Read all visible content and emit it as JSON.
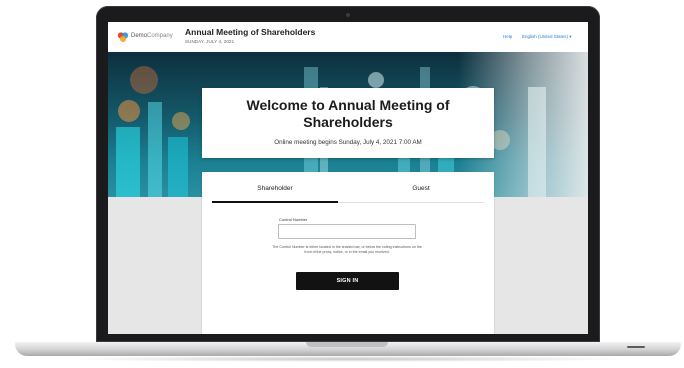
{
  "brand": {
    "logo_name": "DemoCompany",
    "logo_part1": "Demo",
    "logo_part2": "Company"
  },
  "header": {
    "title": "Annual Meeting of Shareholders",
    "date": "SUNDAY, JULY 4, 2021",
    "help_link": "Help",
    "language": "English (United States)",
    "language_icon": "chevron-down-icon"
  },
  "welcome": {
    "title": "Welcome to Annual Meeting of Shareholders",
    "subtitle": "Online meeting begins Sunday, July 4, 2021 7:00 AM"
  },
  "login": {
    "tabs": [
      {
        "label": "Shareholder",
        "active": true
      },
      {
        "label": "Guest",
        "active": false
      }
    ],
    "control_number_label": "Control Number",
    "control_number_value": "",
    "control_number_placeholder": "",
    "help_text": "The Control Number is either located in the shaded bar, or below the voting instructions on the front of the proxy, notice, or in the email you received.",
    "sign_in_label": "SIGN IN"
  },
  "colors": {
    "link": "#2a7fd6",
    "button": "#121212",
    "hero": "#14596a",
    "device": "#1b1b1d"
  }
}
